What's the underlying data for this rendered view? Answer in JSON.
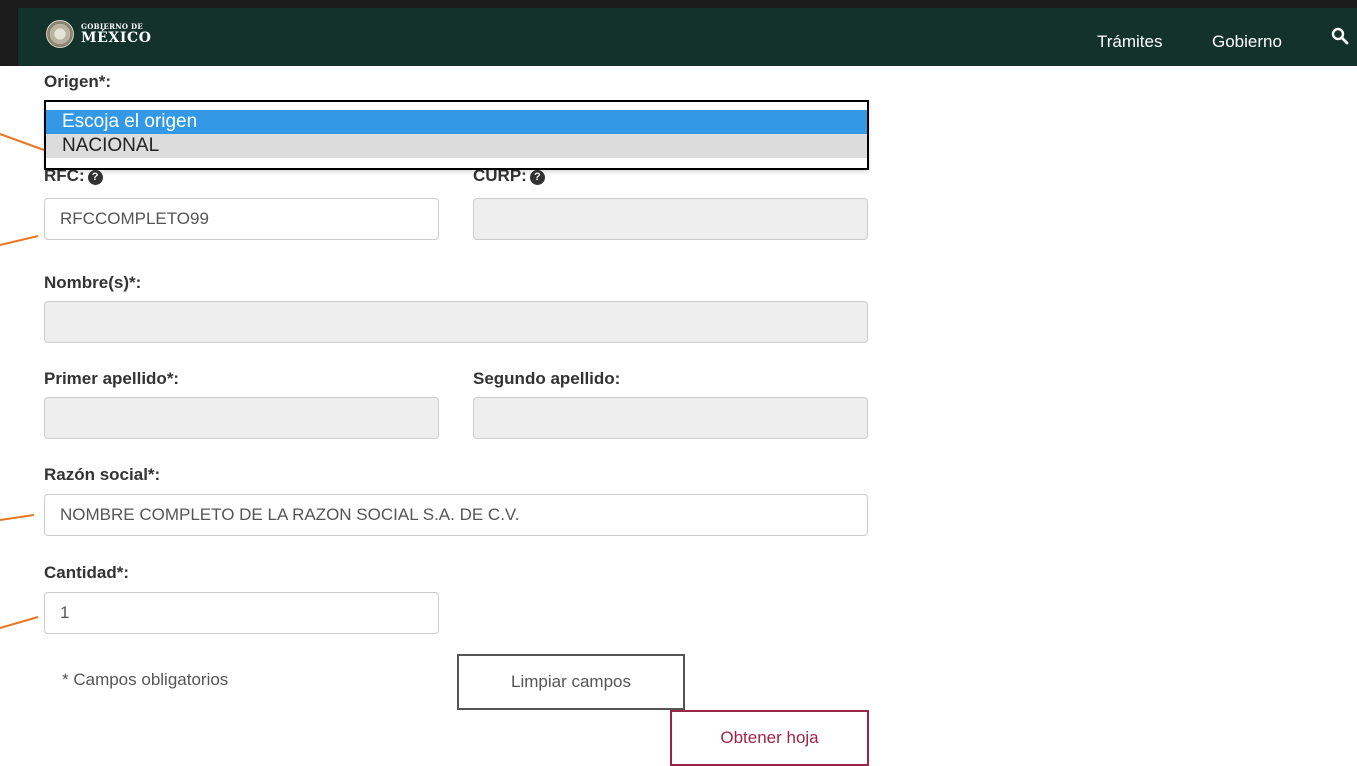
{
  "header": {
    "logo_small": "GOBIERNO DE",
    "logo_big": "MÉXICO",
    "nav": [
      "Trámites",
      "Gobierno"
    ],
    "colors": {
      "bar": "#13322b",
      "accent": "#9d2449"
    }
  },
  "form": {
    "origen": {
      "label": "Origen*:",
      "options": [
        "Escoja el origen",
        "NACIONAL"
      ],
      "highlighted": "Escoja el origen"
    },
    "rfc": {
      "label": "RFC:",
      "value": "RFCCOMPLETO99"
    },
    "curp": {
      "label": "CURP:",
      "value": ""
    },
    "nombre": {
      "label": "Nombre(s)*:",
      "value": ""
    },
    "primer_apellido": {
      "label": "Primer apellido*:",
      "value": ""
    },
    "segundo_apellido": {
      "label": "Segundo apellido:",
      "value": ""
    },
    "razon_social": {
      "label": "Razón social*:",
      "value": "NOMBRE COMPLETO DE LA RAZON SOCIAL S.A. DE C.V."
    },
    "cantidad": {
      "label": "Cantidad*:",
      "value": "1"
    },
    "note": "* Campos obligatorios",
    "clear_label": "Limpiar campos",
    "submit_label": "Obtener hoja"
  }
}
